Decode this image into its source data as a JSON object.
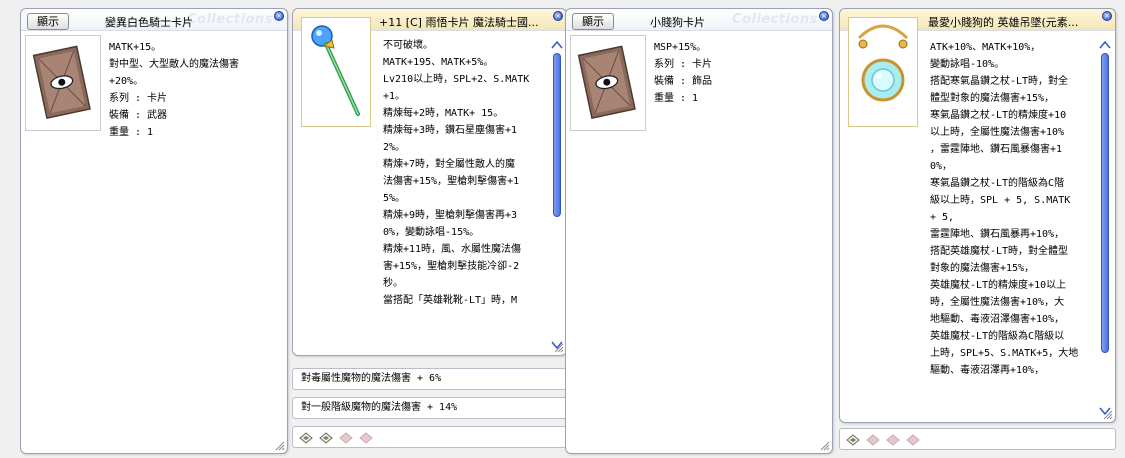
{
  "watermark": "Collections",
  "windows": [
    {
      "show_button": "顯示",
      "title": "變異白色騎士卡片",
      "lines": [
        "MATK+15。",
        "對中型、大型敵人的魔法傷害",
        "+20%。",
        "系列 : 卡片",
        "裝備 : 武器",
        "重量 : 1"
      ]
    },
    {
      "title": "+11 [C] 雨悟卡片 魔法騎士國...",
      "lines": [
        "不可破壞。",
        "MATK+195、MATK+5%。",
        "Lv210以上時，SPL+2、S.MATK",
        "+1。",
        "精煉每+2時，MATK+ 15。",
        "精煉每+3時，鑽石星塵傷害+1",
        "2%。",
        "精煉+7時，對全屬性敵人的魔",
        "法傷害+15%，聖槍刺擊傷害+1",
        "5%。",
        "精煉+9時，聖槍刺擊傷害再+3",
        "0%，變動詠唱-15%。",
        "精煉+11時，風、水屬性魔法傷",
        "害+15%，聖槍刺擊技能冷卻-2",
        "秒。",
        "",
        "當搭配「英雄靴靴-LT」時，M"
      ],
      "options": [
        "對毒屬性魔物的魔法傷害 + 6%",
        "對一般階級魔物的魔法傷害 + 14%"
      ]
    },
    {
      "show_button": "顯示",
      "title": "小賤狗卡片",
      "lines": [
        "MSP+15%。",
        "系列 : 卡片",
        "裝備 : 飾品",
        "重量 : 1"
      ]
    },
    {
      "title": "最愛小賤狗的 英雄吊墜(元素...",
      "lines": [
        "ATK+10%、MATK+10%，",
        "變動詠唱-10%。",
        "",
        "搭配寒氣晶鑽之杖-LT時，對全",
        "體型對象的魔法傷害+15%，",
        "寒氣晶鑽之杖-LT的精煉度+10",
        "以上時，全屬性魔法傷害+10%",
        "，雷霆陣地、鑽石風暴傷害+1",
        "0%，",
        "寒氣晶鑽之杖-LT的階級為C階",
        "級以上時，SPL + 5, S.MATK",
        "+ 5,",
        "雷霆陣地、鑽石風暴再+10%，",
        "搭配英雄魔杖-LT時，對全體型",
        "對象的魔法傷害+15%，",
        "英雄魔杖-LT的精煉度+10以上",
        "時，全屬性魔法傷害+10%，大",
        "地驅動、毒液沼澤傷害+10%，",
        "英雄魔杖-LT的階級為C階級以",
        "上時，SPL+5、S.MATK+5，大地",
        "驅動、毒液沼澤再+10%，"
      ]
    }
  ]
}
